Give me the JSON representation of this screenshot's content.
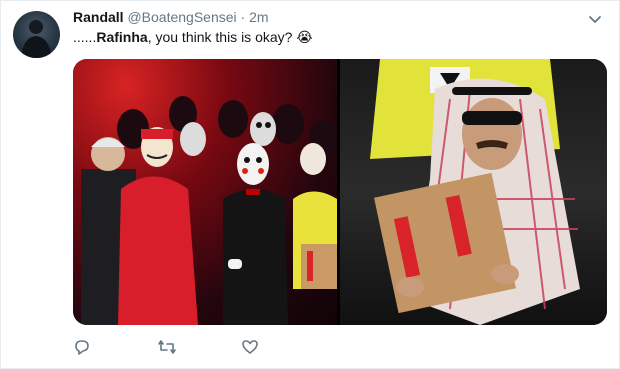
{
  "tweet": {
    "author_name": "Randall",
    "author_handle": "@BoatengSensei",
    "separator": "·",
    "time": "2m",
    "text_prefix": "......",
    "mention": "Rafinha",
    "text_body": ", you think this is okay? 😭"
  },
  "icons": {
    "caret": "chevron-down-icon",
    "reply": "reply-icon",
    "retweet": "retweet-icon",
    "like": "heart-icon"
  },
  "colors": {
    "name": "#14171a",
    "secondary": "#657786",
    "border": "#e6ecf0"
  }
}
